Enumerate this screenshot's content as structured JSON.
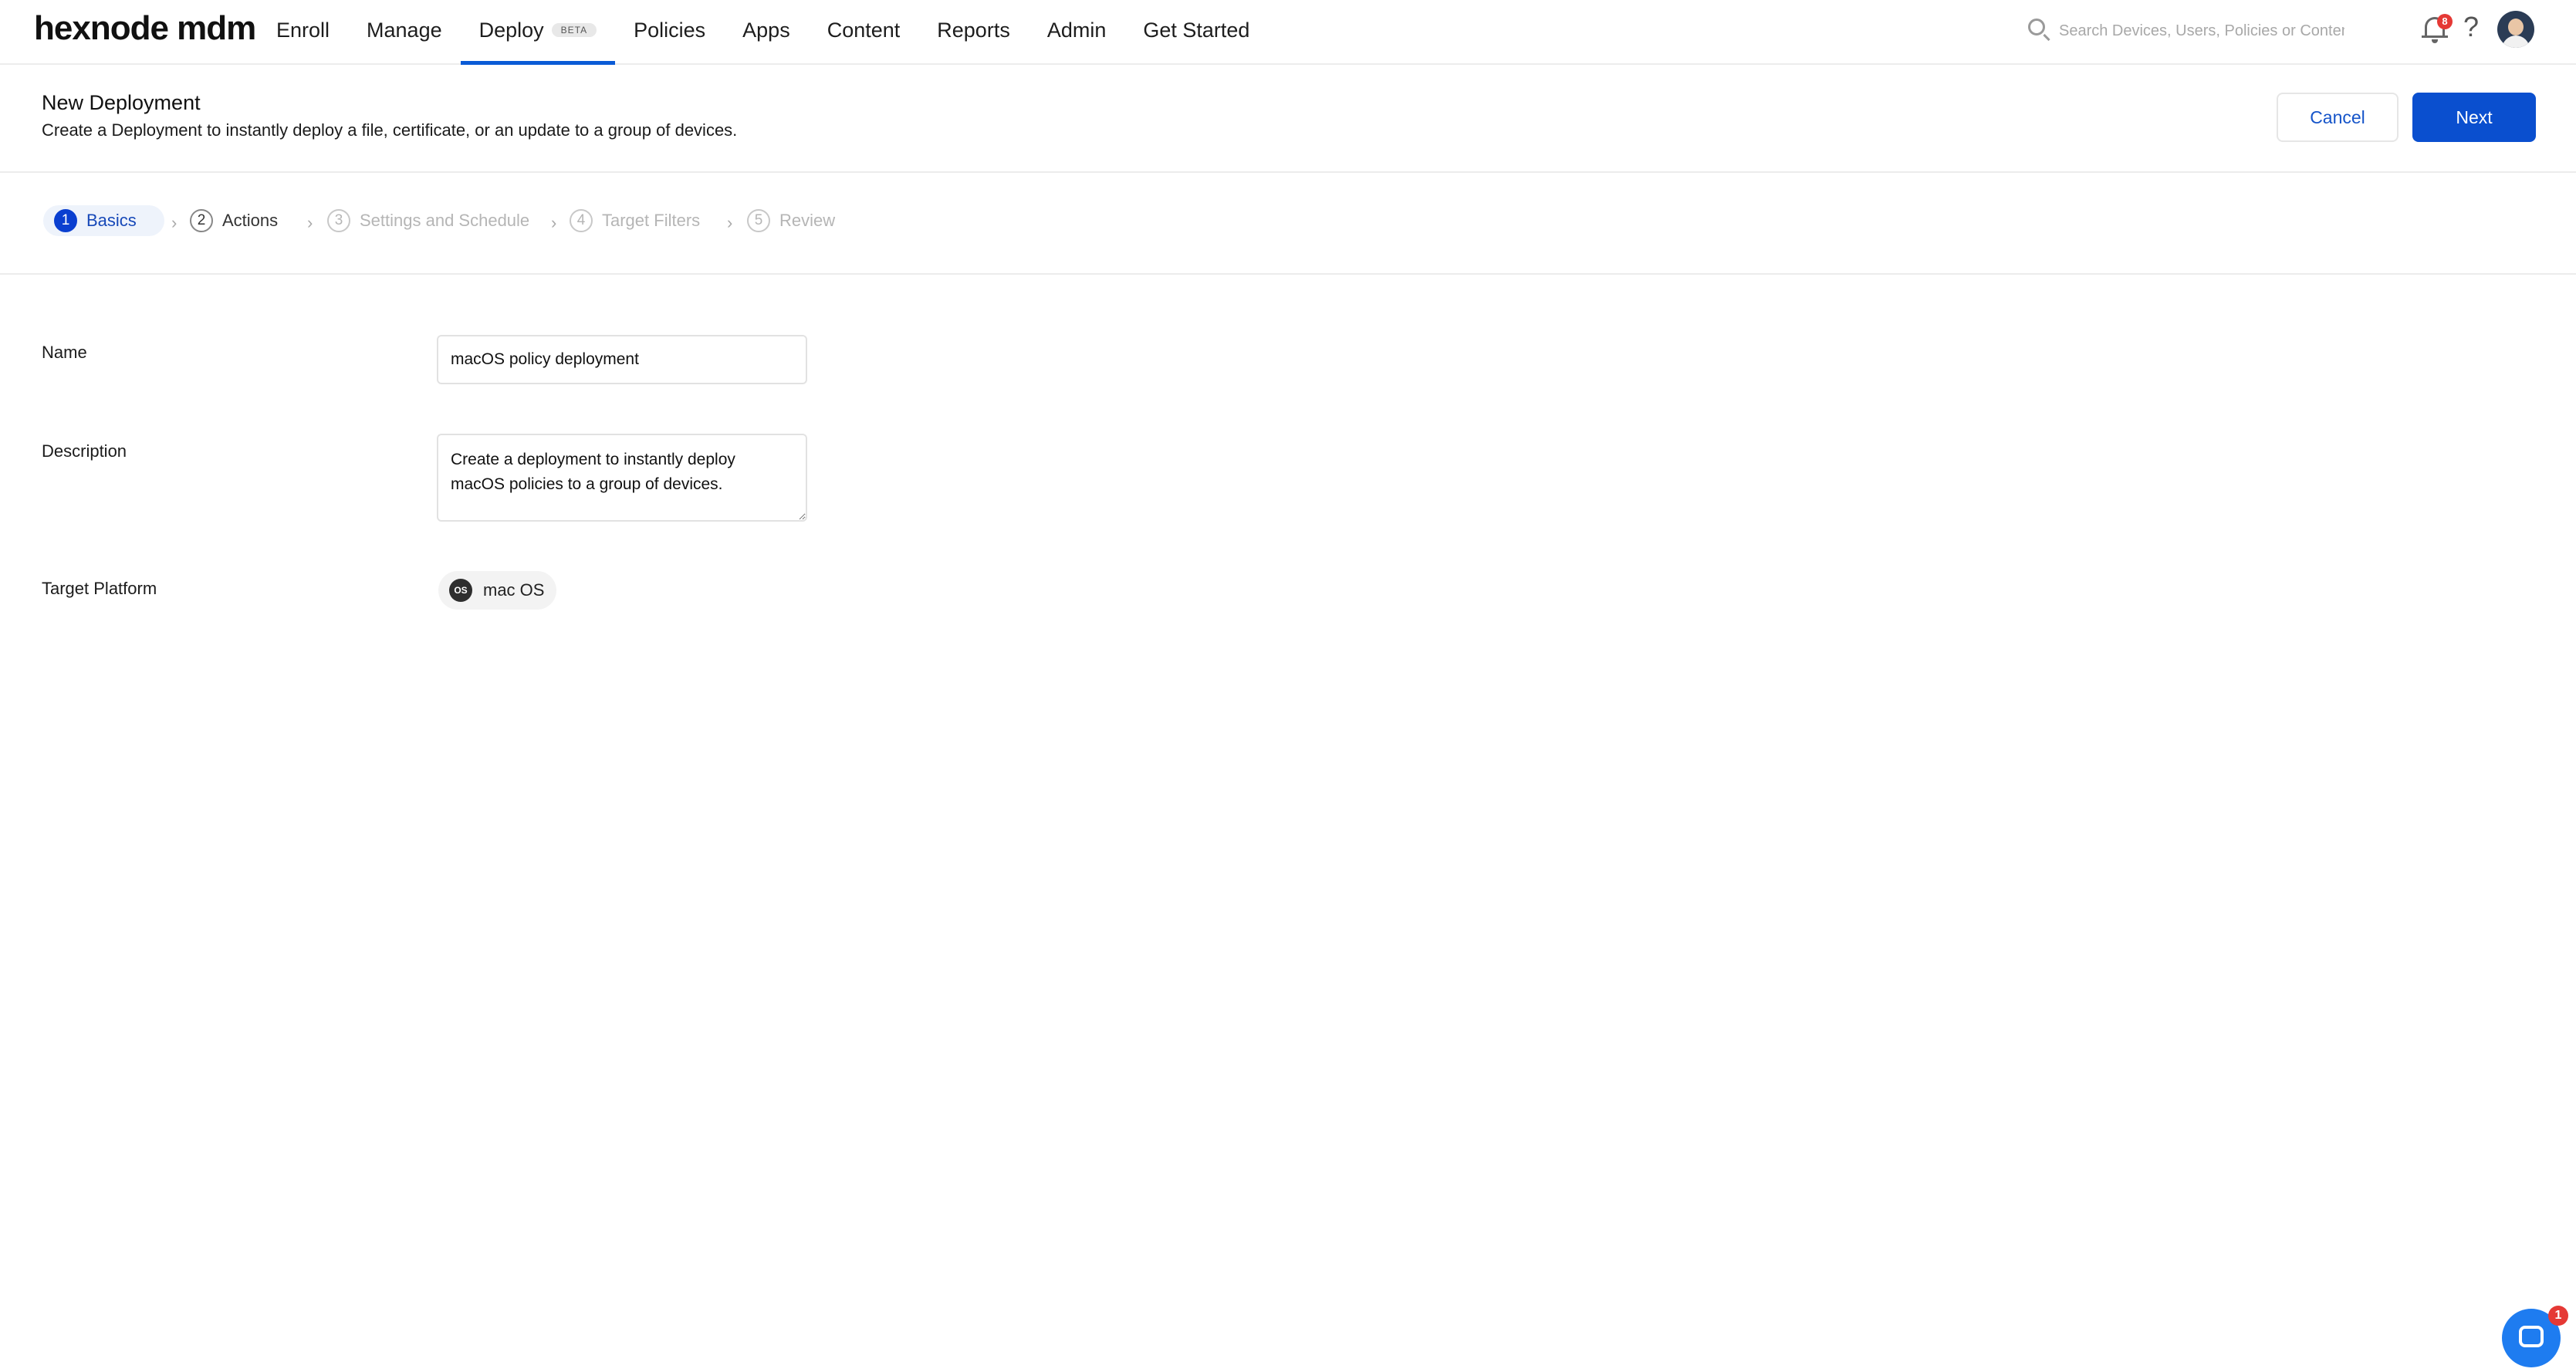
{
  "app": {
    "logo": "hexnode mdm"
  },
  "nav": {
    "items": [
      {
        "label": "Enroll"
      },
      {
        "label": "Manage"
      },
      {
        "label": "Deploy",
        "badge": "BETA",
        "active": true
      },
      {
        "label": "Policies"
      },
      {
        "label": "Apps"
      },
      {
        "label": "Content"
      },
      {
        "label": "Reports"
      },
      {
        "label": "Admin"
      },
      {
        "label": "Get Started"
      }
    ]
  },
  "search": {
    "placeholder": "Search Devices, Users, Policies or Content",
    "icon": "search-icon"
  },
  "notifications": {
    "count": "8",
    "icon": "bell-icon"
  },
  "help": {
    "glyph": "?"
  },
  "header": {
    "title": "New Deployment",
    "subtitle": "Create a Deployment to instantly deploy a file, certificate, or an update to a group of devices.",
    "cancel_label": "Cancel",
    "next_label": "Next"
  },
  "steps": [
    {
      "num": "1",
      "label": "Basics",
      "state": "active"
    },
    {
      "num": "2",
      "label": "Actions",
      "state": "normal"
    },
    {
      "num": "3",
      "label": "Settings and Schedule",
      "state": "disabled"
    },
    {
      "num": "4",
      "label": "Target Filters",
      "state": "disabled"
    },
    {
      "num": "5",
      "label": "Review",
      "state": "disabled"
    }
  ],
  "form": {
    "name_label": "Name",
    "name_value": "macOS policy deployment",
    "description_label": "Description",
    "description_value": "Create a deployment to instantly deploy macOS policies to a group of devices.",
    "platform_label": "Target Platform",
    "platform_icon_text": "OS",
    "platform_value": "mac OS"
  },
  "chat": {
    "badge": "1"
  },
  "colors": {
    "accent": "#0a4fcf",
    "active_step_bg": "#eef3fb",
    "badge": "#e53935"
  }
}
